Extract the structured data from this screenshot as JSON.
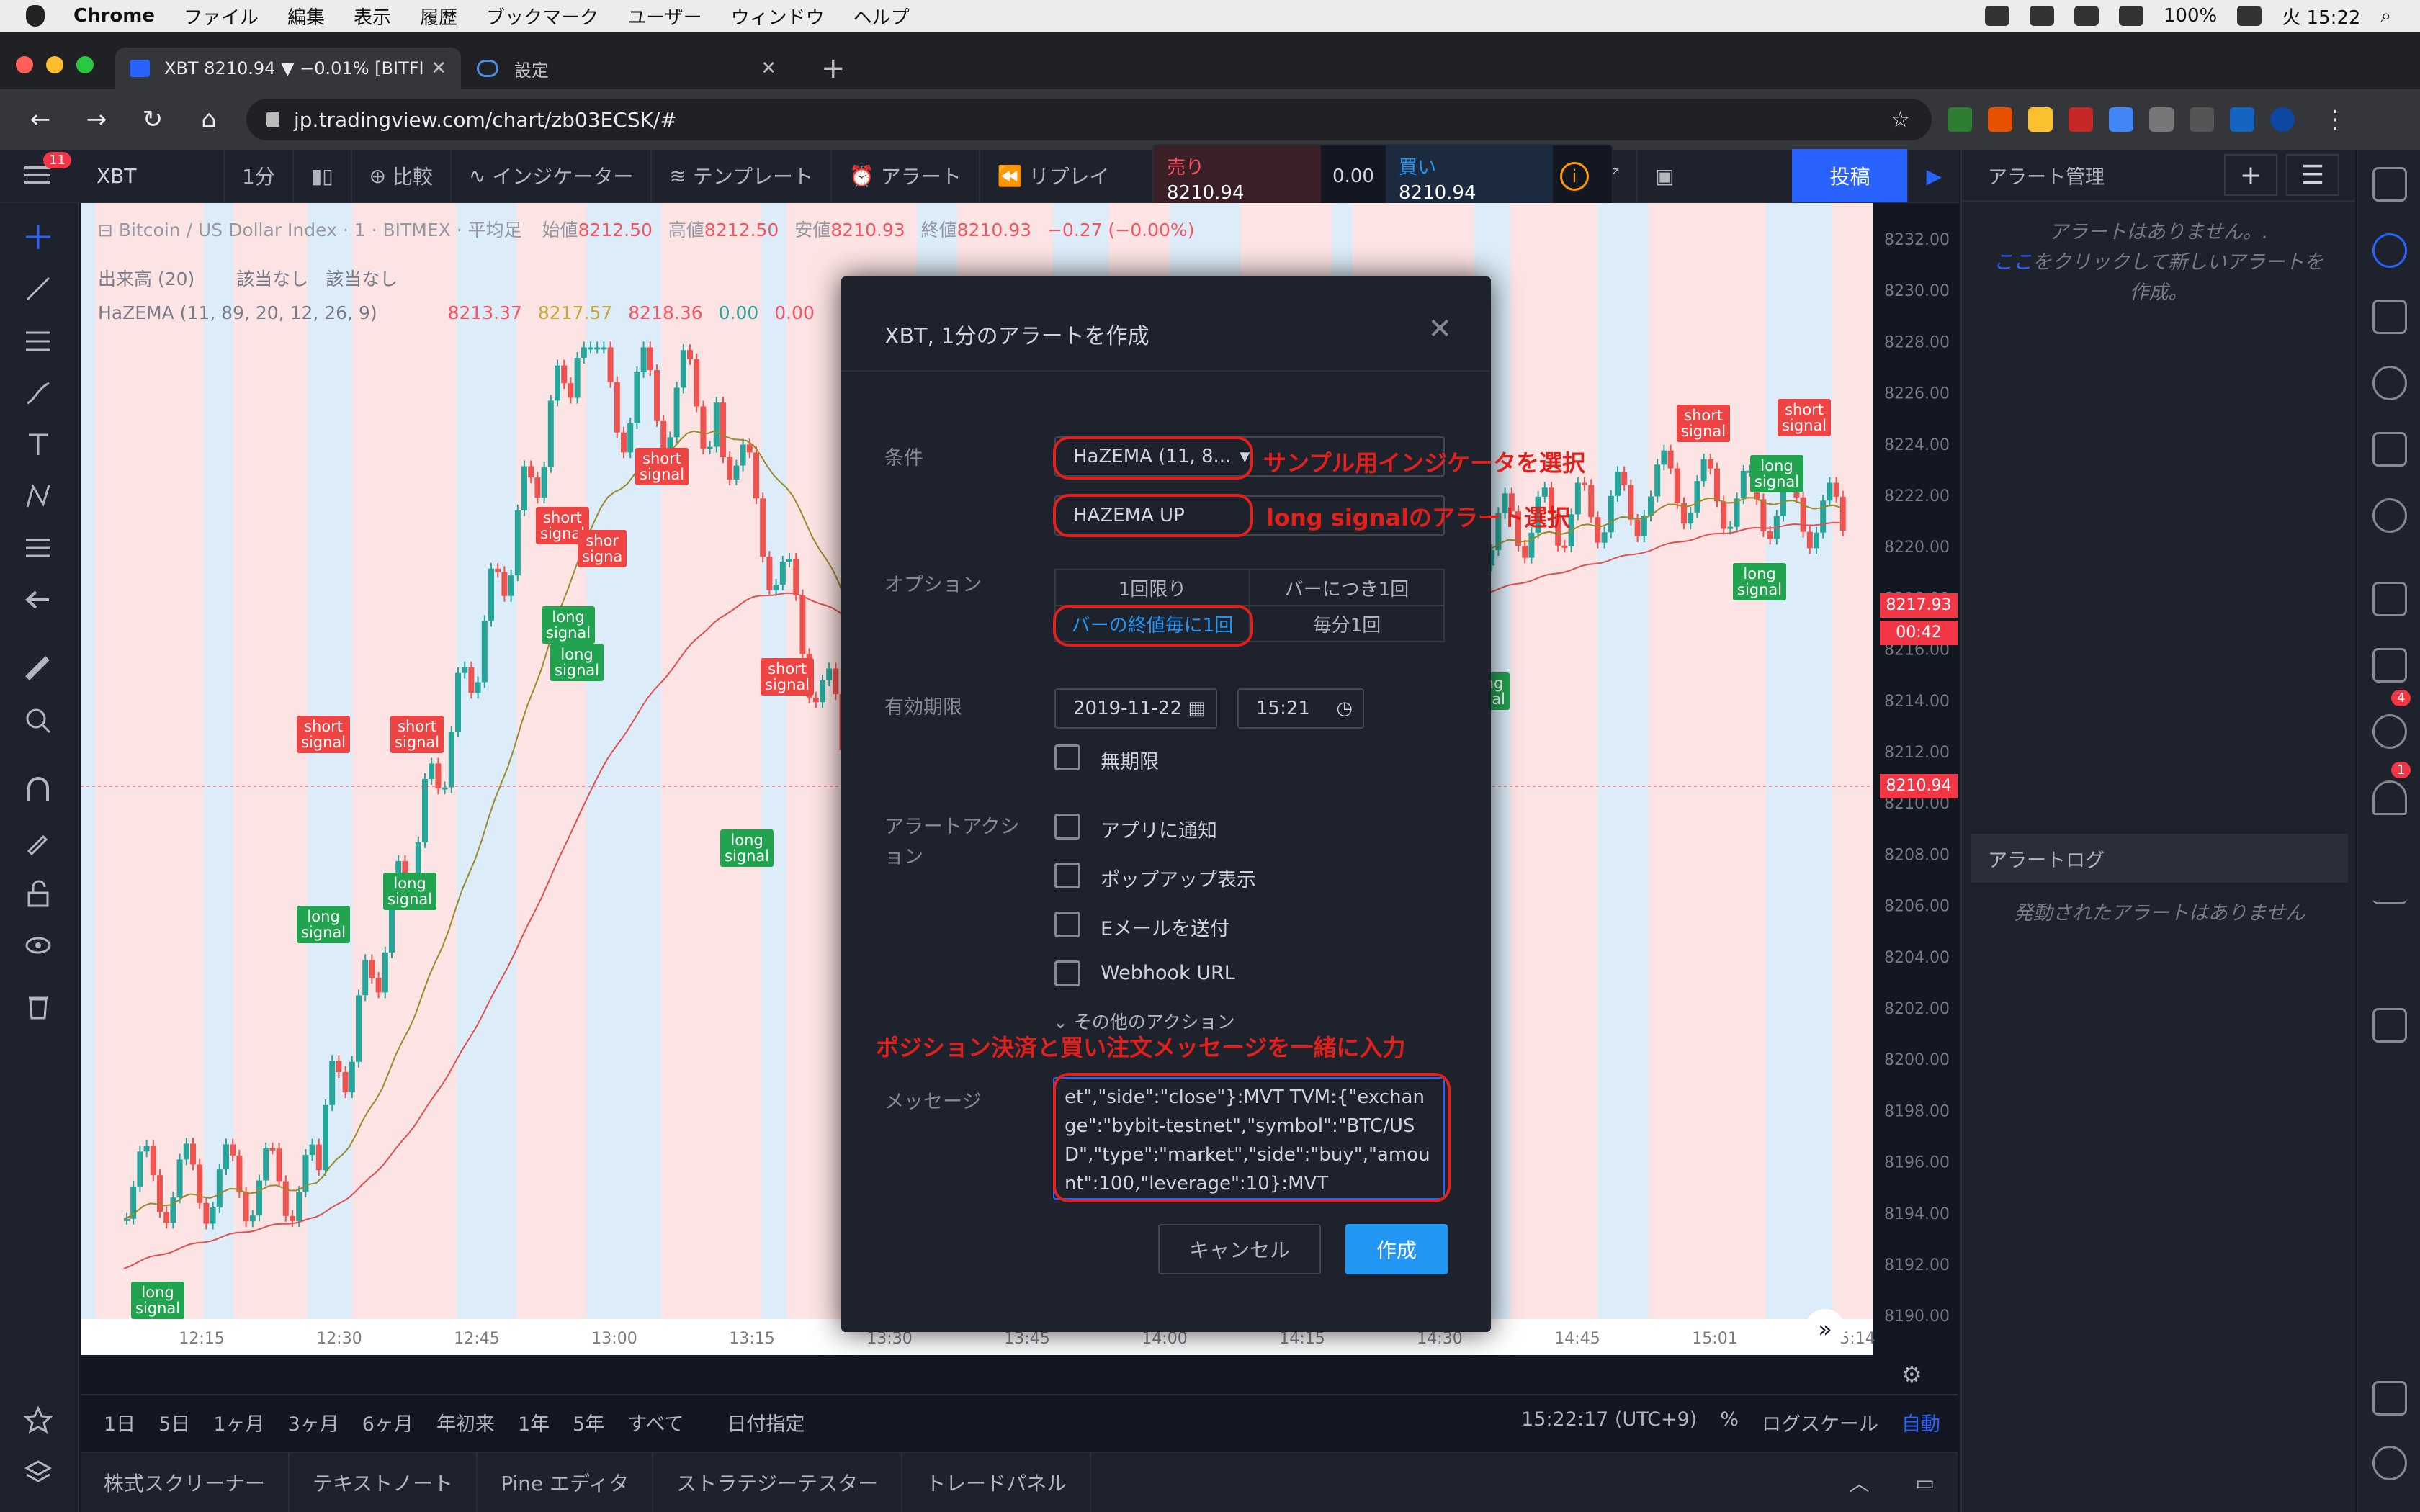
{
  "menubar": {
    "app": "Chrome",
    "items": [
      "ファイル",
      "編集",
      "表示",
      "履歴",
      "ブックマーク",
      "ユーザー",
      "ウィンドウ",
      "ヘルプ"
    ],
    "battery": "100%",
    "day_time": "火 15:22"
  },
  "browser": {
    "tabs": [
      {
        "title": "XBT 8210.94 ▼ −0.01% [BITFI",
        "icon": "tradingview-icon"
      },
      {
        "title": "設定",
        "icon": "cloud-icon"
      }
    ],
    "url": "jp.tradingview.com/chart/zb03ECSK/#"
  },
  "toolbar": {
    "badge": "11",
    "symbol": "XBT",
    "interval": "1分",
    "compare": "比較",
    "indicators": "インジケーター",
    "templates": "テンプレート",
    "alert": "アラート",
    "replay": "リプレイ",
    "publish": "投稿"
  },
  "order": {
    "sell_label": "売り",
    "sell_price": "8210.94",
    "spread": "0.00",
    "buy_label": "買い",
    "buy_price": "8210.94"
  },
  "chart": {
    "title": "Bitcoin / US Dollar Index · 1 · BITMEX · 平均足",
    "ohlc": {
      "o_label": "始値",
      "o": "8212.50",
      "h_label": "高値",
      "h": "8212.50",
      "l_label": "安値",
      "l": "8210.93",
      "c_label": "終値",
      "c": "8210.93",
      "chg": "−0.27 (−0.00%)"
    },
    "volume_legend": "出来高 (20)",
    "volume_values": [
      "該当なし",
      "該当なし"
    ],
    "indicator_legend": "HaZEMA (11, 89, 20, 12, 26, 9)",
    "indicator_values": [
      "8213.37",
      "8217.57",
      "8218.36",
      "0.00",
      "0.00"
    ],
    "price_axis": [
      "8232.00",
      "8230.00",
      "8228.00",
      "8226.00",
      "8224.00",
      "8222.00",
      "8220.00",
      "8218.00",
      "8216.00",
      "8214.00",
      "8212.00",
      "8210.00",
      "8208.00",
      "8206.00",
      "8204.00",
      "8202.00",
      "8200.00",
      "8198.00",
      "8196.00",
      "8194.00",
      "8192.00",
      "8190.00"
    ],
    "time_axis": [
      "12:15",
      "12:30",
      "12:45",
      "13:00",
      "13:15",
      "13:30",
      "13:45",
      "14:00",
      "14:15",
      "14:30",
      "14:45",
      "15:01",
      "15:14"
    ],
    "last_price": "8217.93",
    "countdown": "00:42",
    "current_price": "8210.94",
    "signals": [
      {
        "t": "short\nsignal",
        "k": "s"
      },
      {
        "t": "short\nsignal",
        "k": "s"
      },
      {
        "t": "long\nsignal",
        "k": "l"
      },
      {
        "t": "long\nsignal",
        "k": "l"
      },
      {
        "t": "long\nsignal",
        "k": "l"
      },
      {
        "t": "short\nsignal",
        "k": "s"
      },
      {
        "t": "shor\nsigna",
        "k": "s"
      },
      {
        "t": "long\nsignal",
        "k": "l"
      },
      {
        "t": "long\nsignal",
        "k": "l"
      },
      {
        "t": "short\nsignal",
        "k": "s"
      },
      {
        "t": "short\nsignal",
        "k": "s"
      },
      {
        "t": "long\nsignal",
        "k": "l"
      },
      {
        "t": "short\nsignal",
        "k": "s"
      },
      {
        "t": "short\nsignal",
        "k": "s"
      },
      {
        "t": "short\nsignal",
        "k": "s"
      },
      {
        "t": "long\nsignal",
        "k": "l"
      },
      {
        "t": "long\nsignal",
        "k": "l"
      },
      {
        "t": "ng\nnal",
        "k": "l"
      }
    ]
  },
  "timeframes": [
    "1日",
    "5日",
    "1ヶ月",
    "3ヶ月",
    "6ヶ月",
    "年初来",
    "1年",
    "5年",
    "すべて",
    "日付指定"
  ],
  "status": {
    "clock": "15:22:17 (UTC+9)",
    "percent": "%",
    "log": "ログスケール",
    "auto": "自動"
  },
  "bottom_tabs": [
    "株式スクリーナー",
    "テキストノート",
    "Pine エディタ",
    "ストラテジーテスター",
    "トレードパネル"
  ],
  "alerts_panel": {
    "title": "アラート管理",
    "empty_line1": "アラートはありません。.",
    "empty_link": "ここ",
    "empty_line2": "をクリックして新しいアラートを",
    "empty_line3": "作成。",
    "log_title": "アラートログ",
    "log_empty": "発動されたアラートはありません",
    "badges": [
      "4",
      "1"
    ]
  },
  "dialog": {
    "title": "XBT, 1分のアラートを作成",
    "condition_label": "条件",
    "condition_value": "HaZEMA (11, 8...",
    "condition_sub": "HAZEMA UP",
    "options_label": "オプション",
    "options": [
      "1回限り",
      "バーにつき1回",
      "バーの終値毎に1回",
      "毎分1回"
    ],
    "expiry_label": "有効期限",
    "expiry_date": "2019-11-22",
    "expiry_time": "15:21",
    "open_ended": "無期限",
    "actions_label": "アラートアクション",
    "actions": [
      "アプリに通知",
      "ポップアップ表示",
      "Eメールを送付",
      "Webhook URL"
    ],
    "more_actions": "その他のアクション",
    "message_label": "メッセージ",
    "message": "et\",\"side\":\"close\"}:MVT TVM:{\"exchange\":\"bybit-testnet\",\"symbol\":\"BTC/USD\",\"type\":\"market\",\"side\":\"buy\",\"amount\":100,\"leverage\":10}:MVT",
    "cancel": "キャンセル",
    "create": "作成"
  },
  "annotations": {
    "indicator": "サンプル用インジケータを選択",
    "long": "long signalのアラート選択",
    "message": "ポジション決済と買い注文メッセージを一緒に入力"
  }
}
